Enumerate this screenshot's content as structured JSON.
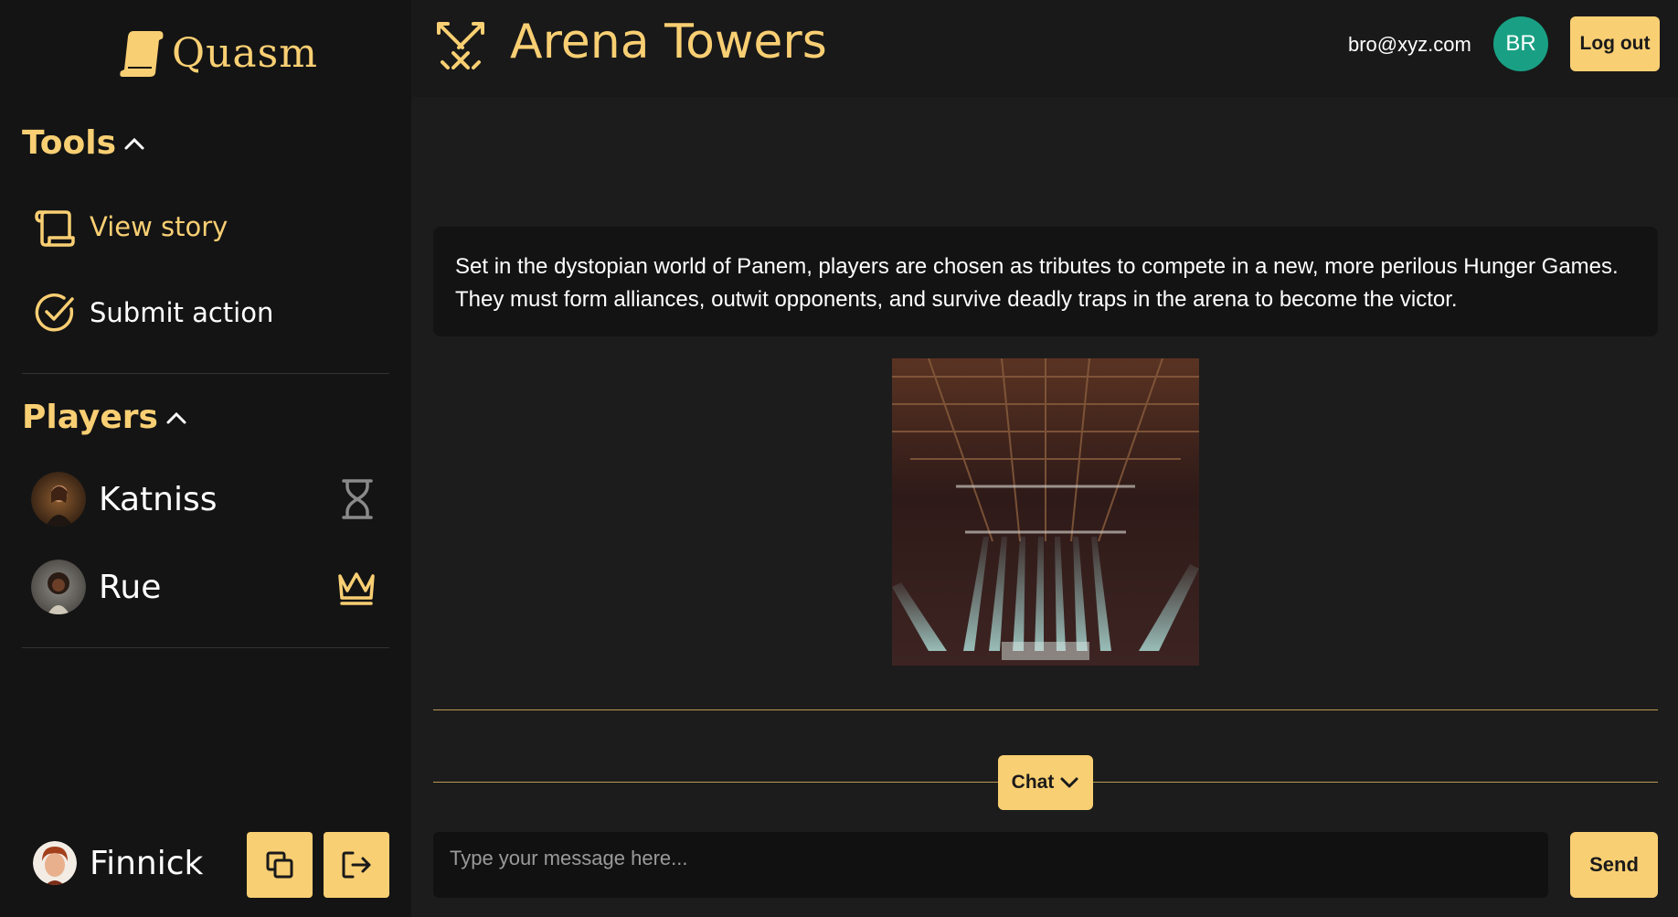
{
  "sidebar": {
    "logo_text": "Quasm",
    "tools_title": "Tools",
    "tools": [
      {
        "label": "View story",
        "icon": "scroll-icon"
      },
      {
        "label": "Submit action",
        "icon": "check-circle-icon"
      }
    ],
    "players_title": "Players",
    "players": [
      {
        "name": "Katniss",
        "status_icon": "hourglass-icon"
      },
      {
        "name": "Rue",
        "status_icon": "crown-icon"
      }
    ],
    "current_user": {
      "name": "Finnick"
    }
  },
  "header": {
    "game_title": "Arena Towers",
    "game_icon": "crossed-swords-icon",
    "email": "bro@xyz.com",
    "avatar_initials": "BR",
    "logout_label": "Log out"
  },
  "main": {
    "story_text": "Set in the dystopian world of Panem, players are chosen as tributes to compete in a new, more perilous Hunger Games. They must form alliances, outwit opponents, and survive deadly traps in the arena to become the victor.",
    "chat_label": "Chat",
    "message_placeholder": "Type your message here...",
    "send_label": "Send"
  },
  "colors": {
    "accent": "#f9cf73",
    "sidebar_bg": "#141414",
    "main_bg": "#1c1c1c",
    "avatar_bg": "#19a084"
  }
}
